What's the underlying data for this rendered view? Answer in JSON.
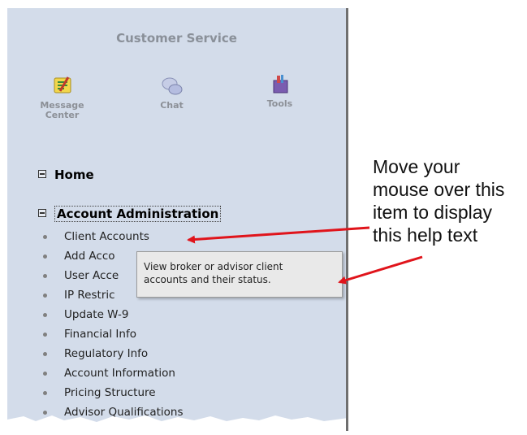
{
  "customer_service": {
    "title": "Customer Service",
    "tools": [
      {
        "label": "Message\nCenter",
        "icon": "message-center-icon"
      },
      {
        "label": "Chat",
        "icon": "chat-icon"
      },
      {
        "label": "Tools",
        "icon": "tools-icon"
      }
    ]
  },
  "tree": {
    "home_label": "Home",
    "account_admin_label": "Account Administration",
    "items": [
      "Client Accounts",
      "Add Acco",
      "User Acce",
      "IP Restric",
      "Update W-9",
      "Financial Info",
      "Regulatory Info",
      "Account Information",
      "Pricing Structure",
      "Advisor Qualifications"
    ]
  },
  "tooltip": {
    "line1": "View broker or advisor client",
    "line2": "accounts and their status."
  },
  "callout": {
    "text": "Move your\nmouse over this\nitem to display\nthis help text"
  },
  "colors": {
    "panel_bg": "#d3dcea",
    "arrow": "#e0141b",
    "tooltip_bg": "#e9e9e9"
  }
}
